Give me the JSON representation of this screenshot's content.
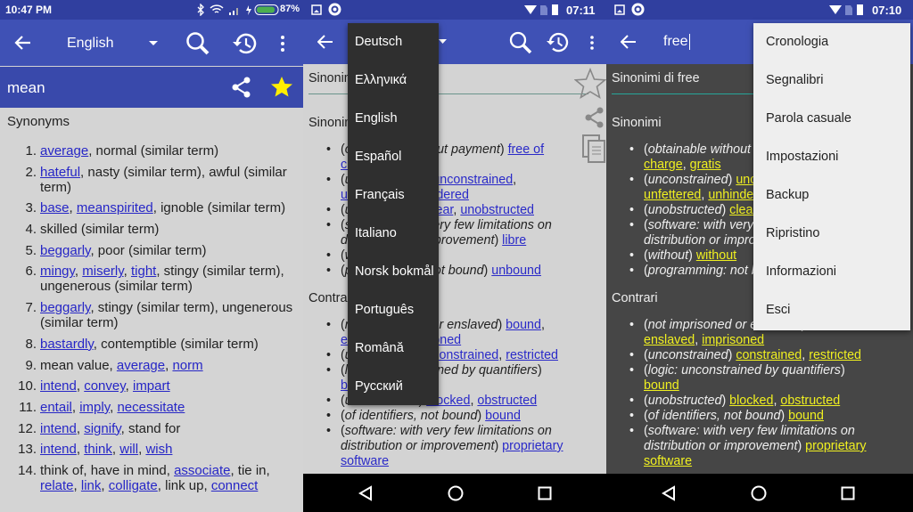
{
  "colors": {
    "primary": "#3f51b5",
    "status": "#303f9f",
    "link_light": "#2626c6",
    "link_dark": "#f0f020",
    "star": "#ffee00",
    "accent": "#26a69a"
  },
  "left": {
    "status": {
      "time": "10:47 PM",
      "battery": "87%"
    },
    "appbar": {
      "language": "English",
      "icons": [
        "back-arrow-icon",
        "dropdown-icon",
        "search-icon",
        "history-icon",
        "more-icon"
      ]
    },
    "word": "mean",
    "section": "Synonyms",
    "items": [
      {
        "n": "1.",
        "s": [
          {
            "t": "average",
            "k": "l"
          },
          {
            "t": ", normal (similar term)"
          }
        ]
      },
      {
        "n": "2.",
        "s": [
          {
            "t": "hateful",
            "k": "l"
          },
          {
            "t": ", nasty (similar term), awful (similar term)"
          }
        ]
      },
      {
        "n": "3.",
        "s": [
          {
            "t": "base",
            "k": "l"
          },
          {
            "t": ", "
          },
          {
            "t": "meanspirited",
            "k": "l"
          },
          {
            "t": ", ignoble (similar term)"
          }
        ]
      },
      {
        "n": "4.",
        "s": [
          {
            "t": "skilled (similar term)"
          }
        ]
      },
      {
        "n": "5.",
        "s": [
          {
            "t": "beggarly",
            "k": "l"
          },
          {
            "t": ", poor (similar term)"
          }
        ]
      },
      {
        "n": "6.",
        "s": [
          {
            "t": "mingy",
            "k": "l"
          },
          {
            "t": ", "
          },
          {
            "t": "miserly",
            "k": "l"
          },
          {
            "t": ", "
          },
          {
            "t": "tight",
            "k": "l"
          },
          {
            "t": ", stingy (similar term), ungenerous (similar term)"
          }
        ]
      },
      {
        "n": "7.",
        "s": [
          {
            "t": "beggarly",
            "k": "l"
          },
          {
            "t": ", stingy (similar term), ungenerous (similar term)"
          }
        ]
      },
      {
        "n": "8.",
        "s": [
          {
            "t": "bastardly",
            "k": "l"
          },
          {
            "t": ", contemptible (similar term)"
          }
        ]
      },
      {
        "n": "9.",
        "s": [
          {
            "t": "mean value, "
          },
          {
            "t": "average",
            "k": "l"
          },
          {
            "t": ", "
          },
          {
            "t": "norm",
            "k": "l"
          }
        ]
      },
      {
        "n": "10.",
        "s": [
          {
            "t": "intend",
            "k": "l"
          },
          {
            "t": ", "
          },
          {
            "t": "convey",
            "k": "l"
          },
          {
            "t": ", "
          },
          {
            "t": "impart",
            "k": "l"
          }
        ]
      },
      {
        "n": "11.",
        "s": [
          {
            "t": "entail",
            "k": "l"
          },
          {
            "t": ", "
          },
          {
            "t": "imply",
            "k": "l"
          },
          {
            "t": ", "
          },
          {
            "t": "necessitate",
            "k": "l"
          }
        ]
      },
      {
        "n": "12.",
        "s": [
          {
            "t": "intend",
            "k": "l"
          },
          {
            "t": ", "
          },
          {
            "t": "signify",
            "k": "l"
          },
          {
            "t": ", stand for"
          }
        ]
      },
      {
        "n": "13.",
        "s": [
          {
            "t": "intend",
            "k": "l"
          },
          {
            "t": ", "
          },
          {
            "t": "think",
            "k": "l"
          },
          {
            "t": ", "
          },
          {
            "t": "will",
            "k": "l"
          },
          {
            "t": ", "
          },
          {
            "t": "wish",
            "k": "l"
          }
        ]
      },
      {
        "n": "14.",
        "s": [
          {
            "t": "think of, have in mind, "
          },
          {
            "t": "associate",
            "k": "l"
          },
          {
            "t": ", tie in, "
          },
          {
            "t": "relate",
            "k": "l"
          },
          {
            "t": ", "
          },
          {
            "t": "link",
            "k": "l"
          },
          {
            "t": ", "
          },
          {
            "t": "colligate",
            "k": "l"
          },
          {
            "t": ", link up, "
          },
          {
            "t": "connect",
            "k": "l"
          }
        ]
      }
    ]
  },
  "middle": {
    "status": {
      "time": "07:11"
    },
    "language_menu": [
      "Deutsch",
      "Ελληνικά",
      "English",
      "Español",
      "Français",
      "Italiano",
      "Norsk bokmål",
      "Português",
      "Română",
      "Русский"
    ]
  },
  "right": {
    "status": {
      "time": "07:10"
    },
    "search_value": "free",
    "overflow_menu": [
      "Cronologia",
      "Segnalibri",
      "Parola casuale",
      "Impostazioni",
      "Backup",
      "Ripristino",
      "Informazioni",
      "Esci"
    ]
  },
  "entry": {
    "title": "Sinonimi di free",
    "sections": [
      {
        "name": "Sinonimi",
        "items": [
          [
            {
              "t": "("
            },
            {
              "t": "obtainable without payment",
              "k": "i"
            },
            {
              "t": ") "
            },
            {
              "t": "free of charge",
              "k": "l"
            },
            {
              "t": ", "
            },
            {
              "t": "gratis",
              "k": "l"
            }
          ],
          [
            {
              "t": "("
            },
            {
              "t": "unconstrained",
              "k": "i"
            },
            {
              "t": ") "
            },
            {
              "t": "unconstrained",
              "k": "l"
            },
            {
              "t": ", "
            },
            {
              "t": "unfettered",
              "k": "l"
            },
            {
              "t": ", "
            },
            {
              "t": "unhindered",
              "k": "l"
            }
          ],
          [
            {
              "t": "("
            },
            {
              "t": "unobstructed",
              "k": "i"
            },
            {
              "t": ") "
            },
            {
              "t": "clear",
              "k": "l"
            },
            {
              "t": ", "
            },
            {
              "t": "unobstructed",
              "k": "l"
            }
          ],
          [
            {
              "t": "("
            },
            {
              "t": "software: with very few limitations on distribution or improvement",
              "k": "i"
            },
            {
              "t": ") "
            },
            {
              "t": "libre",
              "k": "l"
            }
          ],
          [
            {
              "t": "("
            },
            {
              "t": "without",
              "k": "i"
            },
            {
              "t": ") "
            },
            {
              "t": "without",
              "k": "l"
            }
          ],
          [
            {
              "t": "("
            },
            {
              "t": "programming: not bound",
              "k": "i"
            },
            {
              "t": ") "
            },
            {
              "t": "unbound",
              "k": "l"
            }
          ]
        ]
      },
      {
        "name": "Contrari",
        "items": [
          [
            {
              "t": "("
            },
            {
              "t": "not imprisoned or enslaved",
              "k": "i"
            },
            {
              "t": ") "
            },
            {
              "t": "bound",
              "k": "l"
            },
            {
              "t": ", "
            },
            {
              "t": "enslaved",
              "k": "l"
            },
            {
              "t": ", "
            },
            {
              "t": "imprisoned",
              "k": "l"
            }
          ],
          [
            {
              "t": "("
            },
            {
              "t": "unconstrained",
              "k": "i"
            },
            {
              "t": ") "
            },
            {
              "t": "constrained",
              "k": "l"
            },
            {
              "t": ", "
            },
            {
              "t": "restricted",
              "k": "l"
            }
          ],
          [
            {
              "t": "("
            },
            {
              "t": "logic: unconstrained by quantifiers",
              "k": "i"
            },
            {
              "t": ") "
            },
            {
              "t": "bound",
              "k": "l"
            }
          ],
          [
            {
              "t": "("
            },
            {
              "t": "unobstructed",
              "k": "i"
            },
            {
              "t": ") "
            },
            {
              "t": "blocked",
              "k": "l"
            },
            {
              "t": ", "
            },
            {
              "t": "obstructed",
              "k": "l"
            }
          ],
          [
            {
              "t": "("
            },
            {
              "t": "of identifiers, not bound",
              "k": "i"
            },
            {
              "t": ") "
            },
            {
              "t": "bound",
              "k": "l"
            }
          ],
          [
            {
              "t": "("
            },
            {
              "t": "software: with very few limitations on distribution or improvement",
              "k": "i"
            },
            {
              "t": ") "
            },
            {
              "t": "proprietary software",
              "k": "l"
            }
          ]
        ]
      }
    ]
  }
}
